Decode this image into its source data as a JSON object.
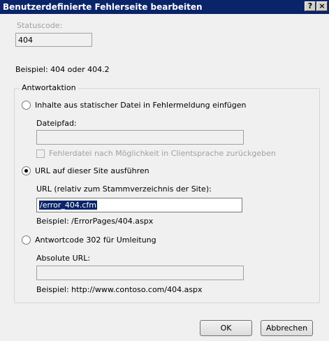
{
  "dialog": {
    "title": "Benutzerdefinierte Fehlerseite bearbeiten",
    "help_label": "?",
    "close_label": "×"
  },
  "status_code": {
    "label": "Statuscode:",
    "value": "404",
    "example": "Beispiel: 404 oder 404.2"
  },
  "response_action": {
    "legend": "Antwortaktion",
    "static_file": {
      "label": "Inhalte aus statischer Datei in Fehlermeldung einfügen",
      "selected": false,
      "path_label": "Dateipfad:",
      "path_value": "",
      "localized_checkbox_label": "Fehlerdatei nach Möglichkeit in Clientsprache zurückgeben",
      "localized_checked": false
    },
    "execute_url": {
      "label": "URL auf dieser Site ausführen",
      "selected": true,
      "url_label": "URL (relativ zum Stammverzeichnis der Site):",
      "url_value": "/error_404.cfm",
      "example": "Beispiel: /ErrorPages/404.aspx"
    },
    "redirect": {
      "label": "Antwortcode 302 für Umleitung",
      "selected": false,
      "absolute_url_label": "Absolute URL:",
      "absolute_url_value": "",
      "example": "Beispiel: http://www.contoso.com/404.aspx"
    }
  },
  "buttons": {
    "ok": "OK",
    "cancel": "Abbrechen"
  }
}
